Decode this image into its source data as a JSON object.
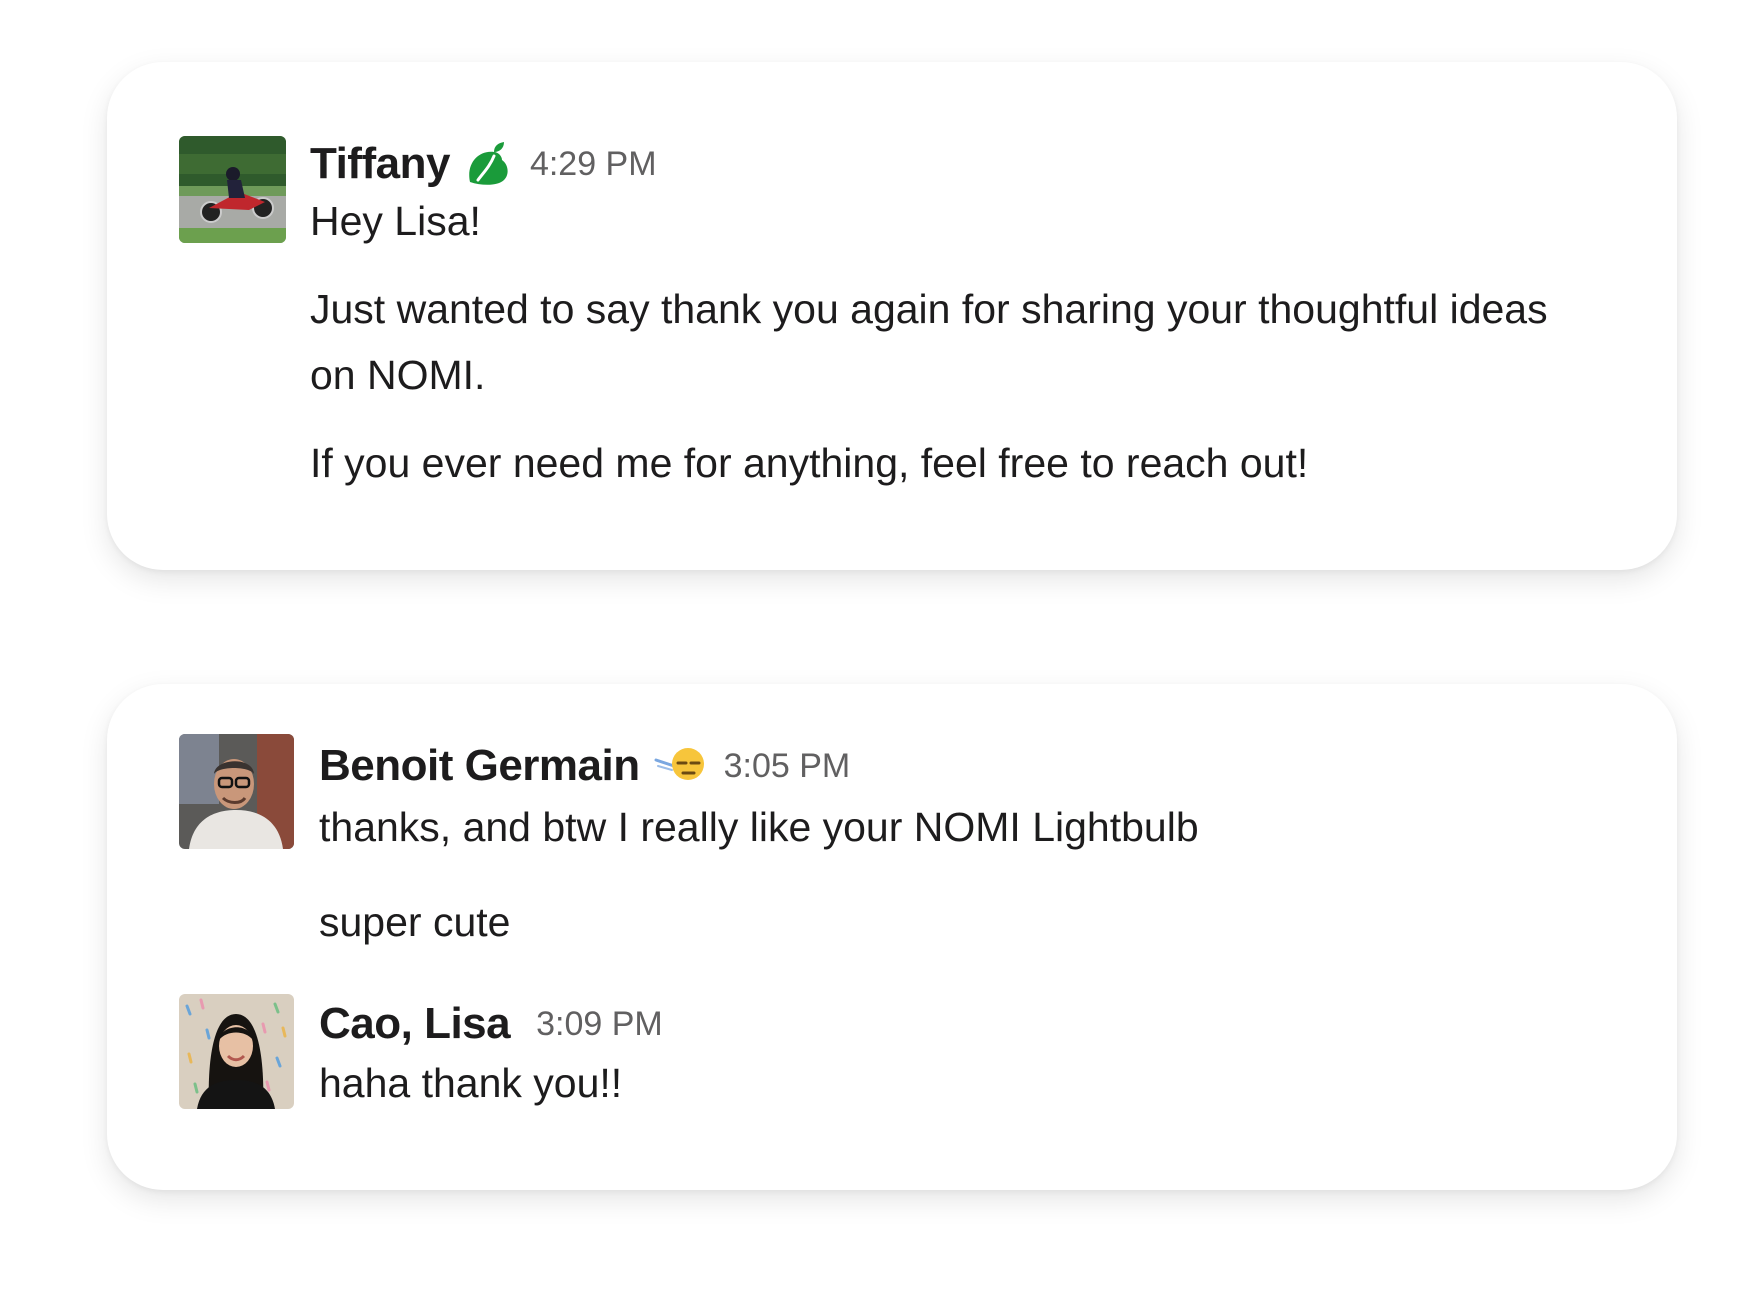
{
  "messages_top": {
    "tiffany": {
      "name": "Tiffany",
      "status_icon": "leaf-icon",
      "time": "4:29 PM",
      "lines": [
        "Hey Lisa!",
        "Just wanted to say thank you again for sharing your thoughtful ideas on NOMI.",
        "If you ever need me for anything, feel free to reach out!"
      ]
    }
  },
  "messages_bottom": {
    "benoit": {
      "name": "Benoit Germain",
      "status_icon": "sleepy-face-icon",
      "time": "3:05 PM",
      "lines": [
        "thanks, and btw I really like your NOMI Lightbulb",
        "super cute"
      ]
    },
    "lisa": {
      "name": "Cao, Lisa",
      "time": "3:09 PM",
      "lines": [
        "haha thank you!!"
      ]
    }
  },
  "colors": {
    "text": "#1d1c1d",
    "timestamp": "#616061",
    "leaf_green": "#1a9b3a",
    "card_background": "#ffffff"
  }
}
